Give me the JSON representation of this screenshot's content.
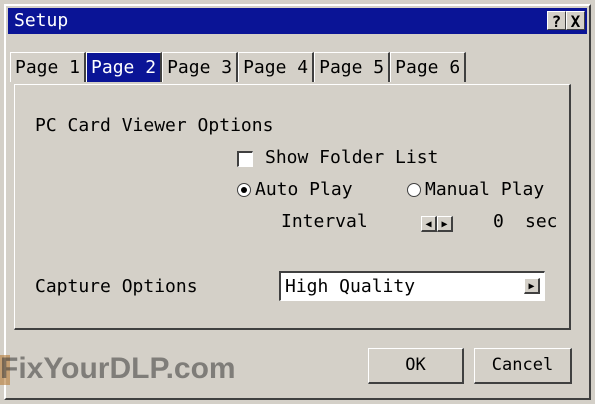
{
  "window": {
    "title": "Setup",
    "help_label": "?",
    "close_label": "X"
  },
  "tabs": [
    {
      "label": "Page 1",
      "active": false
    },
    {
      "label": "Page 2",
      "active": true
    },
    {
      "label": "Page 3",
      "active": false
    },
    {
      "label": "Page 4",
      "active": false
    },
    {
      "label": "Page 5",
      "active": false
    },
    {
      "label": "Page 6",
      "active": false
    }
  ],
  "pc_card": {
    "section_label": "PC Card Viewer Options",
    "show_folder_list": {
      "label": "Show Folder List",
      "checked": false
    },
    "auto_play": {
      "label": "Auto Play",
      "selected": true
    },
    "manual_play": {
      "label": "Manual Play",
      "selected": false
    },
    "interval": {
      "label": "Interval",
      "value": "0",
      "unit": "sec",
      "left_arrow": "◀",
      "right_arrow": "▶"
    }
  },
  "capture": {
    "label": "Capture Options",
    "value": "High Quality",
    "dropdown_arrow": "▶"
  },
  "buttons": {
    "ok": "OK",
    "cancel": "Cancel"
  },
  "watermark": "FixYourDLP.com"
}
